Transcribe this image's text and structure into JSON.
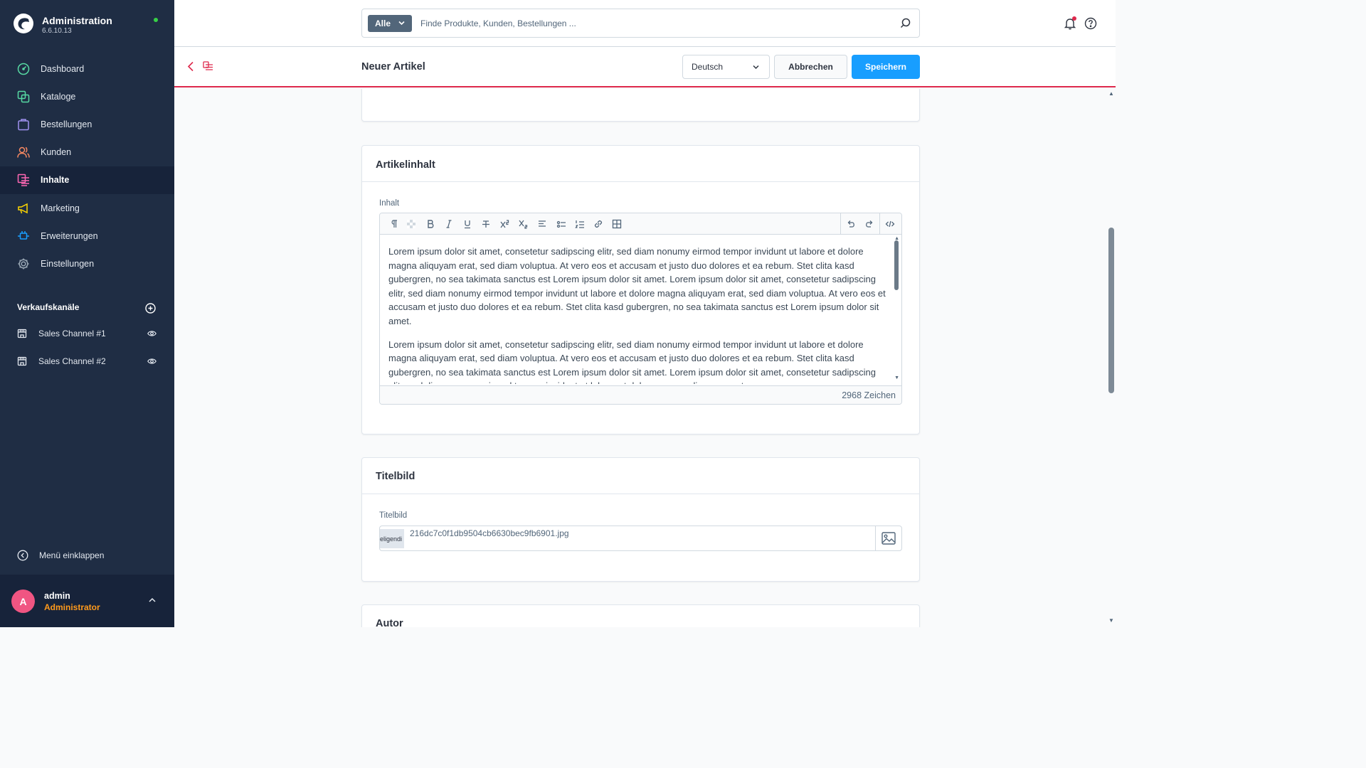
{
  "app": {
    "title": "Administration",
    "version": "6.6.10.13"
  },
  "sidebar": {
    "items": [
      {
        "label": "Dashboard",
        "icon": "dashboard-icon",
        "color": "#57d9a3"
      },
      {
        "label": "Kataloge",
        "icon": "catalog-icon",
        "color": "#57d9a3"
      },
      {
        "label": "Bestellungen",
        "icon": "orders-icon",
        "color": "#a092f0"
      },
      {
        "label": "Kunden",
        "icon": "customers-icon",
        "color": "#f88962"
      },
      {
        "label": "Inhalte",
        "icon": "content-icon",
        "color": "#ff68b4"
      },
      {
        "label": "Marketing",
        "icon": "marketing-icon",
        "color": "#ffd700"
      },
      {
        "label": "Erweiterungen",
        "icon": "extensions-icon",
        "color": "#189eff"
      },
      {
        "label": "Einstellungen",
        "icon": "settings-icon",
        "color": "#9aa8b5"
      }
    ],
    "active_item": "Inhalte",
    "sales_channels_title": "Verkaufskanäle",
    "sales_channels": [
      {
        "label": "Sales Channel #1"
      },
      {
        "label": "Sales Channel #2"
      }
    ],
    "collapse_label": "Menü einklappen"
  },
  "user": {
    "initial": "A",
    "name": "admin",
    "role": "Administrator"
  },
  "search": {
    "type_label": "Alle",
    "placeholder": "Finde Produkte, Kunden, Bestellungen ..."
  },
  "smartbar": {
    "title": "Neuer Artikel",
    "language": "Deutsch",
    "cancel_label": "Abbrechen",
    "save_label": "Speichern"
  },
  "article_content": {
    "card_title": "Artikelinhalt",
    "field_label": "Inhalt",
    "paragraphs": [
      "Lorem ipsum dolor sit amet, consetetur sadipscing elitr, sed diam nonumy eirmod tempor invidunt ut labore et dolore magna aliquyam erat, sed diam voluptua. At vero eos et accusam et justo duo dolores et ea rebum. Stet clita kasd gubergren, no sea takimata sanctus est Lorem ipsum dolor sit amet. Lorem ipsum dolor sit amet, consetetur sadipscing elitr, sed diam nonumy eirmod tempor invidunt ut labore et dolore magna aliquyam erat, sed diam voluptua. At vero eos et accusam et justo duo dolores et ea rebum. Stet clita kasd gubergren, no sea takimata sanctus est Lorem ipsum dolor sit amet.",
      "Lorem ipsum dolor sit amet, consetetur sadipscing elitr, sed diam nonumy eirmod tempor invidunt ut labore et dolore magna aliquyam erat, sed diam voluptua. At vero eos et accusam et justo duo dolores et ea rebum. Stet clita kasd gubergren, no sea takimata sanctus est Lorem ipsum dolor sit amet. Lorem ipsum dolor sit amet, consetetur sadipscing elitr, sed diam nonumy eirmod tempor invidunt ut labore et dolore magna aliquyam erat."
    ],
    "char_count": "2968 Zeichen"
  },
  "title_image": {
    "card_title": "Titelbild",
    "field_label": "Titelbild",
    "thumb_text": "eligendi",
    "file_name": "216dc7c0f1db9504cb6630bec9fb6901.jpg"
  },
  "author": {
    "card_title": "Autor"
  }
}
